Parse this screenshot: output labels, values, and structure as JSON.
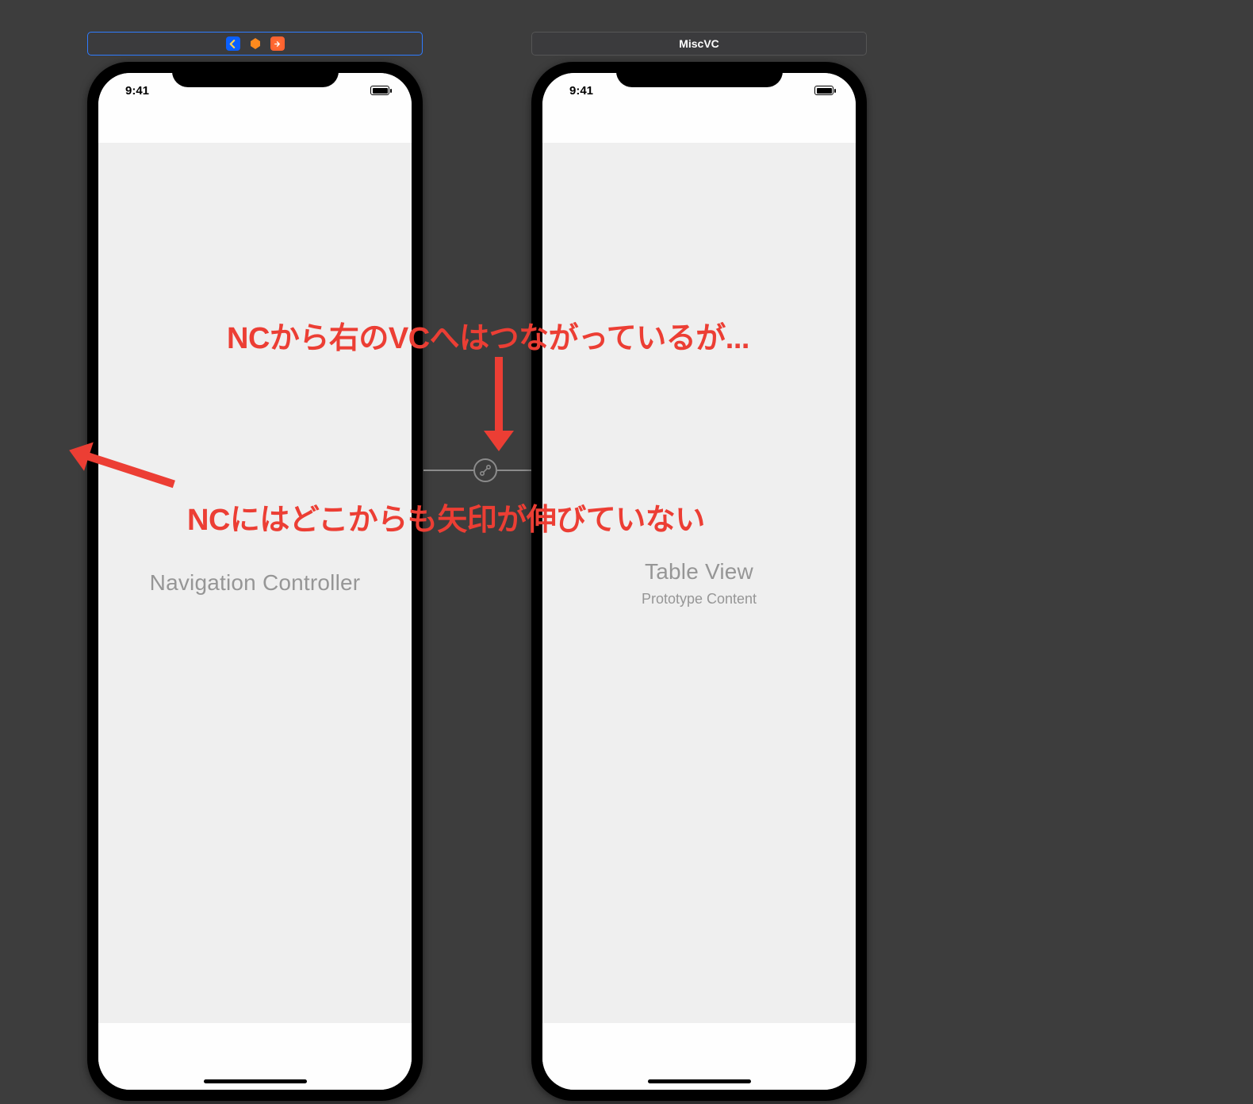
{
  "scenes": {
    "left": {
      "title": "",
      "selected": true,
      "content_main": "Navigation Controller",
      "content_sub": "",
      "status_time": "9:41"
    },
    "right": {
      "title": "MiscVC",
      "selected": false,
      "content_main": "Table View",
      "content_sub": "Prototype Content",
      "status_time": "9:41"
    }
  },
  "annotations": {
    "top": "NCから右のVCへはつながっているが...",
    "mid": "NCにはどこからも矢印が伸びていない"
  },
  "icons": {
    "back": "◂",
    "first_responder": "◉",
    "exit": "▣"
  }
}
